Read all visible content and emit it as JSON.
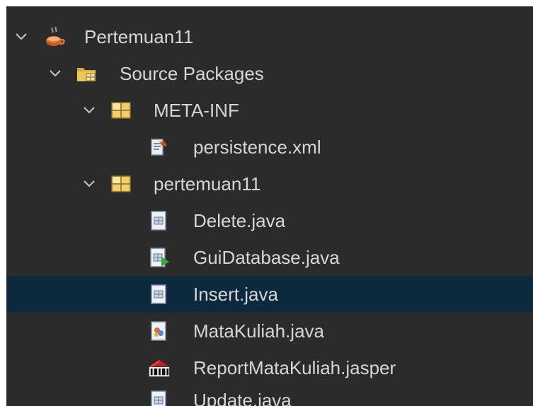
{
  "tree": {
    "items": [
      {
        "label": "Pertemuan11",
        "icon": "java-project-icon",
        "expanded": true
      },
      {
        "label": "Source Packages",
        "icon": "source-packages-folder-icon",
        "expanded": true
      },
      {
        "label": "META-INF",
        "icon": "package-icon",
        "expanded": true
      },
      {
        "label": "persistence.xml",
        "icon": "persistence-xml-icon"
      },
      {
        "label": "pertemuan11",
        "icon": "package-icon",
        "expanded": true
      },
      {
        "label": "Delete.java",
        "icon": "java-file-icon"
      },
      {
        "label": "GuiDatabase.java",
        "icon": "java-form-file-icon"
      },
      {
        "label": "Insert.java",
        "icon": "java-file-icon",
        "selected": true
      },
      {
        "label": "MataKuliah.java",
        "icon": "java-bean-file-icon"
      },
      {
        "label": "ReportMataKuliah.jasper",
        "icon": "jasper-report-icon"
      },
      {
        "label": "Update.java",
        "icon": "java-file-icon"
      }
    ]
  },
  "colors": {
    "background": "#2b2b2b",
    "selection": "#0d293e",
    "text": "#d6d6d6"
  }
}
